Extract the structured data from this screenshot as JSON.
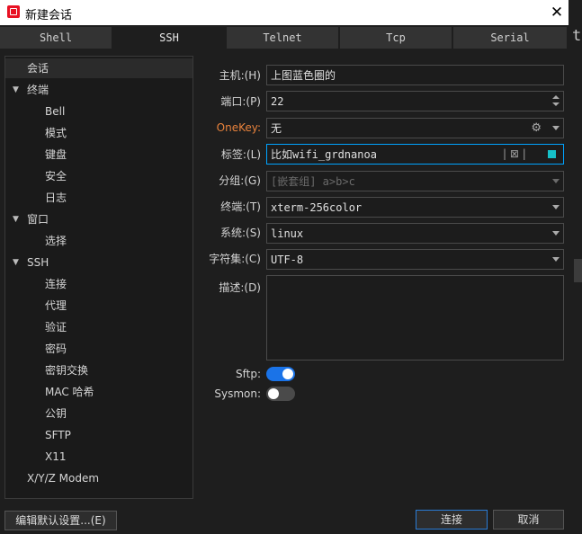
{
  "window": {
    "title": "新建会话",
    "close_glyph": "✕",
    "right_strip_text": "t"
  },
  "tabs": [
    {
      "label": "Shell",
      "active": false
    },
    {
      "label": "SSH",
      "active": true
    },
    {
      "label": "Telnet",
      "active": false
    },
    {
      "label": "Tcp",
      "active": false
    },
    {
      "label": "Serial",
      "active": false
    }
  ],
  "tree": {
    "items": [
      {
        "label": "会话",
        "level": 0,
        "selected": true,
        "expandable": false
      },
      {
        "label": "终端",
        "level": 0,
        "selected": false,
        "expandable": true
      },
      {
        "label": "Bell",
        "level": 1
      },
      {
        "label": "模式",
        "level": 1
      },
      {
        "label": "键盘",
        "level": 1
      },
      {
        "label": "安全",
        "level": 1
      },
      {
        "label": "日志",
        "level": 1
      },
      {
        "label": "窗口",
        "level": 0,
        "expandable": true
      },
      {
        "label": "选择",
        "level": 1
      },
      {
        "label": "SSH",
        "level": 0,
        "expandable": true
      },
      {
        "label": "连接",
        "level": 1
      },
      {
        "label": "代理",
        "level": 1
      },
      {
        "label": "验证",
        "level": 1
      },
      {
        "label": "密码",
        "level": 1
      },
      {
        "label": "密钥交换",
        "level": 1
      },
      {
        "label": "MAC 哈希",
        "level": 1
      },
      {
        "label": "公钥",
        "level": 1
      },
      {
        "label": "SFTP",
        "level": 1
      },
      {
        "label": "X11",
        "level": 1
      },
      {
        "label": "X/Y/Z Modem",
        "level": 0,
        "expandable": false
      }
    ]
  },
  "form": {
    "host": {
      "label": "主机:(H)",
      "value": "上图蓝色圈的"
    },
    "port": {
      "label": "端口:(P)",
      "value": "22"
    },
    "onekey": {
      "label": "OneKey:",
      "value": "无",
      "label_color": "#e8823c"
    },
    "tag": {
      "label": "标签:(L)",
      "value": "比如wifi_grdnanoa",
      "tools": "| ⊠ |",
      "color_swatch": "#16c0c8"
    },
    "group": {
      "label": "分组:(G)",
      "placeholder": "[嵌套组] a>b>c"
    },
    "terminal": {
      "label": "终端:(T)",
      "value": "xterm-256color"
    },
    "system": {
      "label": "系统:(S)",
      "value": "linux"
    },
    "charset": {
      "label": "字符集:(C)",
      "value": "UTF-8"
    },
    "description": {
      "label": "描述:(D)",
      "value": ""
    },
    "sftp": {
      "label": "Sftp:",
      "on": true
    },
    "sysmon": {
      "label": "Sysmon:",
      "on": false
    }
  },
  "buttons": {
    "edit_defaults": "编辑默认设置...(E)",
    "connect": "连接",
    "cancel": "取消"
  },
  "colors": {
    "accent": "#1a73e8",
    "focus_border": "#00a3ff",
    "background": "#1e1e1e"
  }
}
